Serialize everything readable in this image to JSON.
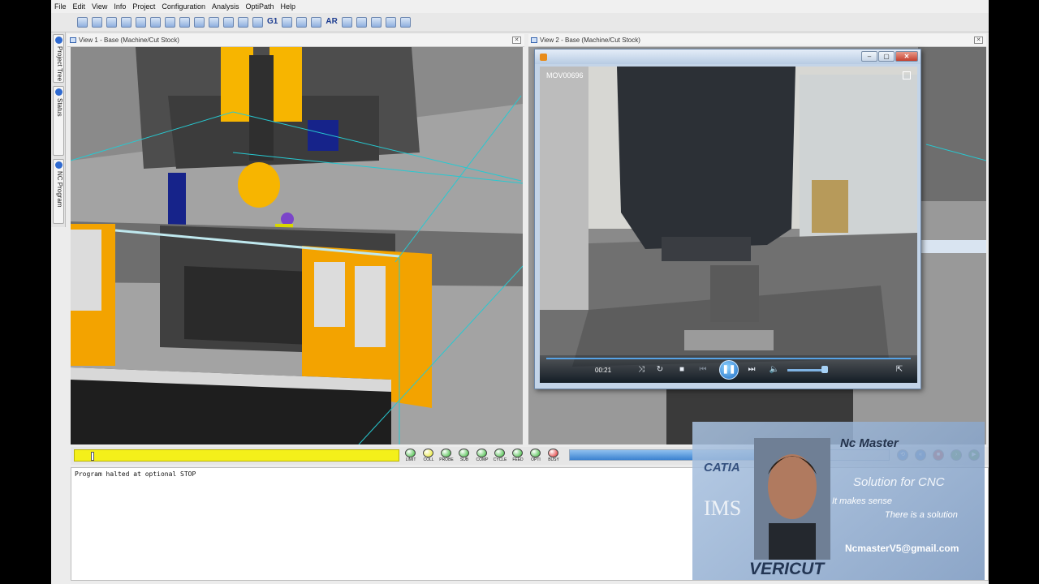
{
  "menu": [
    "File",
    "Edit",
    "View",
    "Info",
    "Project",
    "Configuration",
    "Analysis",
    "OptiPath",
    "Help"
  ],
  "toolbar": {
    "g1_label": "G1",
    "ar_label": "AR"
  },
  "left_tabs": [
    "Project Tree",
    "Status",
    "NC Program"
  ],
  "views": {
    "view1_title": "View 1 - Base (Machine/Cut Stock)",
    "view2_title": "View 2 - Base (Machine/Cut Stock)"
  },
  "player": {
    "video_title": "MOV00696",
    "current_time": "00:21",
    "seek_progress": 1.0,
    "volume_level": 0.85
  },
  "indicators": [
    {
      "label": "LIMIT",
      "color": "#2fb52f"
    },
    {
      "label": "COLL",
      "color": "#e8e81a"
    },
    {
      "label": "PROBE",
      "color": "#2fb52f"
    },
    {
      "label": "SUB",
      "color": "#2fb52f"
    },
    {
      "label": "COMP",
      "color": "#2fb52f"
    },
    {
      "label": "CYCLE",
      "color": "#2fb52f"
    },
    {
      "label": "FEED",
      "color": "#2fb52f"
    },
    {
      "label": "OPTI",
      "color": "#2fb52f"
    },
    {
      "label": "BUSY",
      "color": "#e02020"
    }
  ],
  "simulation": {
    "slider_level": 0.05,
    "progress": 0.69
  },
  "log": {
    "message": "Program halted at optional STOP"
  },
  "watermark": {
    "brand": "Nc Master",
    "catia": "CATIA",
    "solution": "Solution for CNC",
    "ims": "IMS",
    "makes_sense": "It makes sense",
    "there_is": "There is a solution",
    "email": "NcmasterV5@gmail.com",
    "vericut": "VERICUT"
  }
}
